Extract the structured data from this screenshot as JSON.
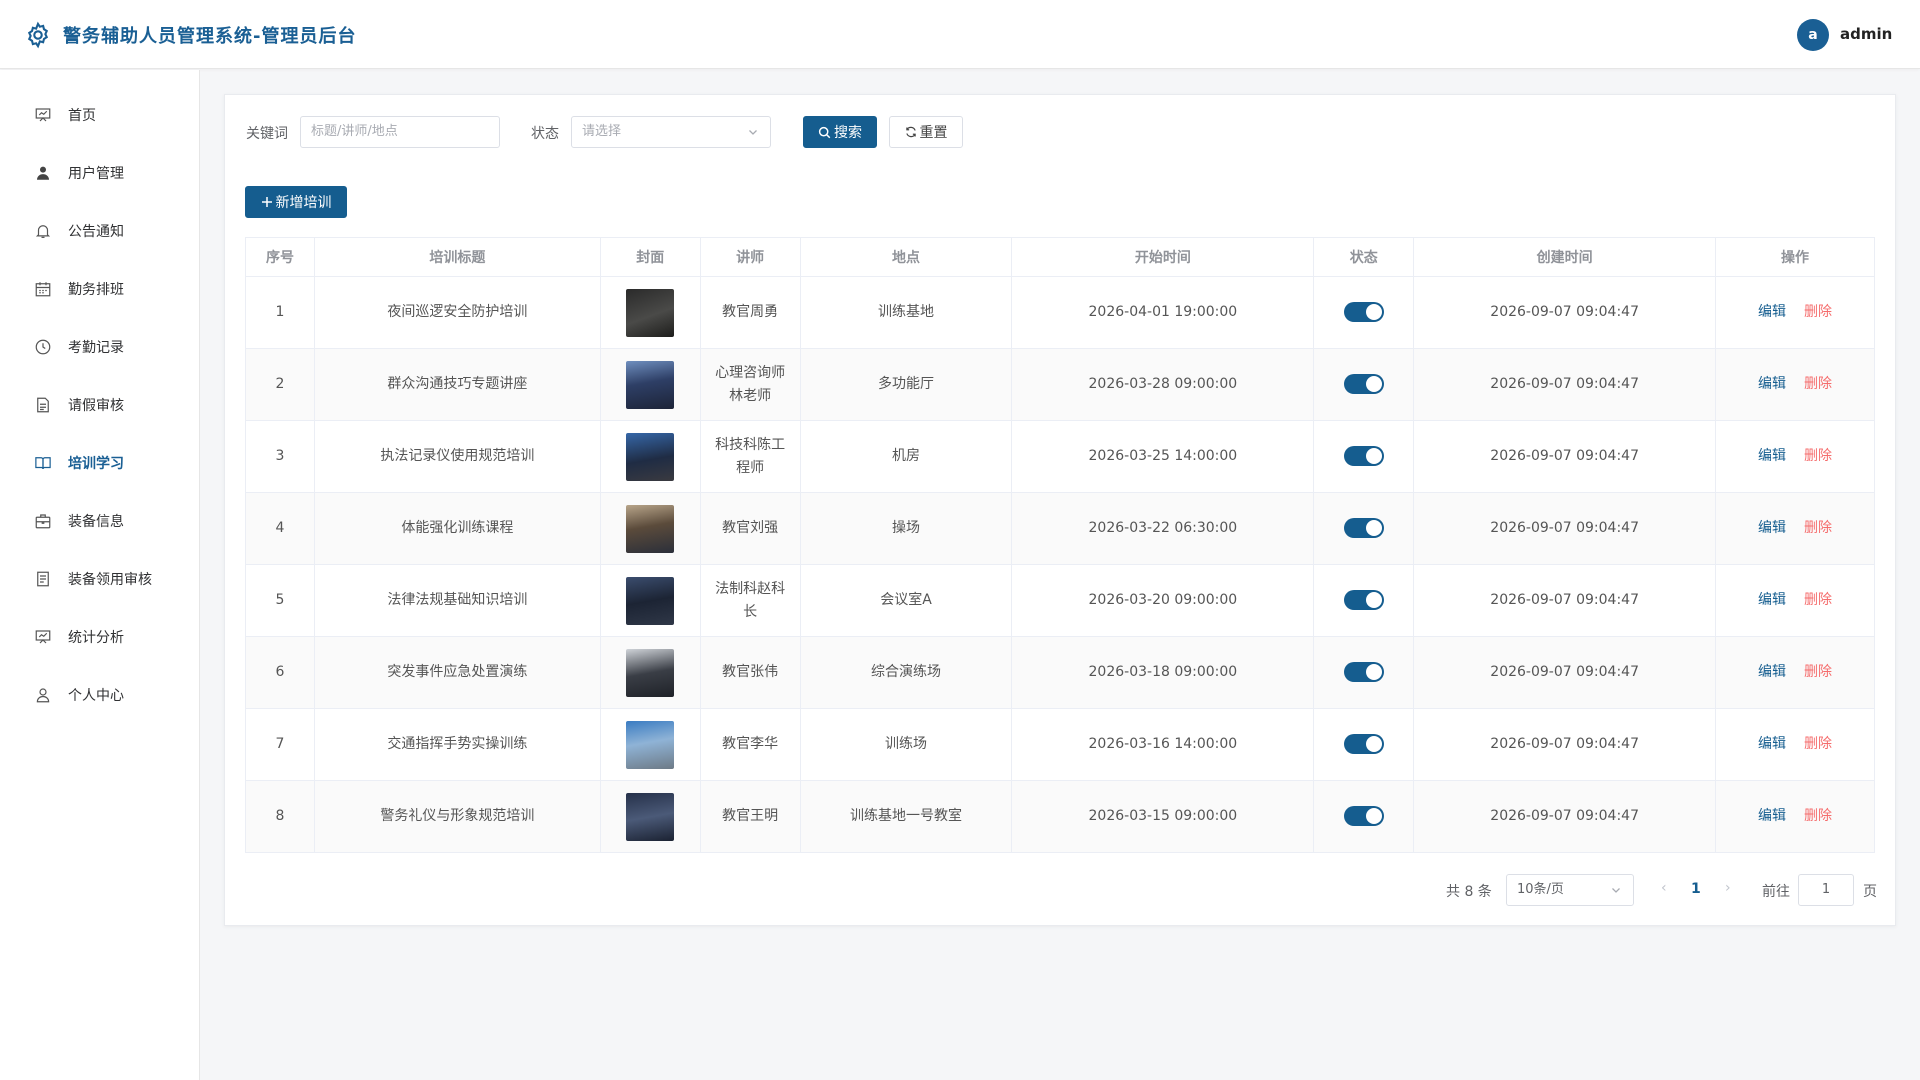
{
  "header": {
    "title": "警务辅助人员管理系统-管理员后台",
    "avatar_letter": "a",
    "username": "admin"
  },
  "sidebar": {
    "items": [
      {
        "label": "首页",
        "icon": "presentation-icon"
      },
      {
        "label": "用户管理",
        "icon": "user-icon"
      },
      {
        "label": "公告通知",
        "icon": "bell-icon"
      },
      {
        "label": "勤务排班",
        "icon": "calendar-icon"
      },
      {
        "label": "考勤记录",
        "icon": "clock-icon"
      },
      {
        "label": "请假审核",
        "icon": "document-icon"
      },
      {
        "label": "培训学习",
        "icon": "book-icon"
      },
      {
        "label": "装备信息",
        "icon": "suitcase-icon"
      },
      {
        "label": "装备领用审核",
        "icon": "document-list-icon"
      },
      {
        "label": "统计分析",
        "icon": "chart-board-icon"
      },
      {
        "label": "个人中心",
        "icon": "person-icon"
      }
    ],
    "active_index": 6
  },
  "filters": {
    "keyword_label": "关键词",
    "keyword_placeholder": "标题/讲师/地点",
    "status_label": "状态",
    "status_placeholder": "请选择",
    "search_label": "搜索",
    "reset_label": "重置"
  },
  "add_button_label": "新增培训",
  "table": {
    "columns": [
      "序号",
      "培训标题",
      "封面",
      "讲师",
      "地点",
      "开始时间",
      "状态",
      "创建时间",
      "操作"
    ],
    "rows": [
      {
        "no": "1",
        "title": "夜间巡逻安全防护培训",
        "teacher": "教官周勇",
        "location": "训练基地",
        "start": "2026-04-01 19:00:00",
        "enabled": true,
        "created": "2026-09-07 09:04:47"
      },
      {
        "no": "2",
        "title": "群众沟通技巧专题讲座",
        "teacher": "心理咨询师林老师",
        "location": "多功能厅",
        "start": "2026-03-28 09:00:00",
        "enabled": true,
        "created": "2026-09-07 09:04:47"
      },
      {
        "no": "3",
        "title": "执法记录仪使用规范培训",
        "teacher": "科技科陈工程师",
        "location": "机房",
        "start": "2026-03-25 14:00:00",
        "enabled": true,
        "created": "2026-09-07 09:04:47"
      },
      {
        "no": "4",
        "title": "体能强化训练课程",
        "teacher": "教官刘强",
        "location": "操场",
        "start": "2026-03-22 06:30:00",
        "enabled": true,
        "created": "2026-09-07 09:04:47"
      },
      {
        "no": "5",
        "title": "法律法规基础知识培训",
        "teacher": "法制科赵科长",
        "location": "会议室A",
        "start": "2026-03-20 09:00:00",
        "enabled": true,
        "created": "2026-09-07 09:04:47"
      },
      {
        "no": "6",
        "title": "突发事件应急处置演练",
        "teacher": "教官张伟",
        "location": "综合演练场",
        "start": "2026-03-18 09:00:00",
        "enabled": true,
        "created": "2026-09-07 09:04:47"
      },
      {
        "no": "7",
        "title": "交通指挥手势实操训练",
        "teacher": "教官李华",
        "location": "训练场",
        "start": "2026-03-16 14:00:00",
        "enabled": true,
        "created": "2026-09-07 09:04:47"
      },
      {
        "no": "8",
        "title": "警务礼仪与形象规范培训",
        "teacher": "教官王明",
        "location": "训练基地一号教室",
        "start": "2026-03-15 09:00:00",
        "enabled": true,
        "created": "2026-09-07 09:04:47"
      }
    ],
    "edit_label": "编辑",
    "delete_label": "删除"
  },
  "pagination": {
    "total_text": "共 8 条",
    "page_size": "10条/页",
    "current_page": "1",
    "goto_label": "前往",
    "goto_value": "1",
    "page_suffix": "页"
  },
  "colors": {
    "primary": "#155d8f",
    "danger": "#f56c6c"
  }
}
